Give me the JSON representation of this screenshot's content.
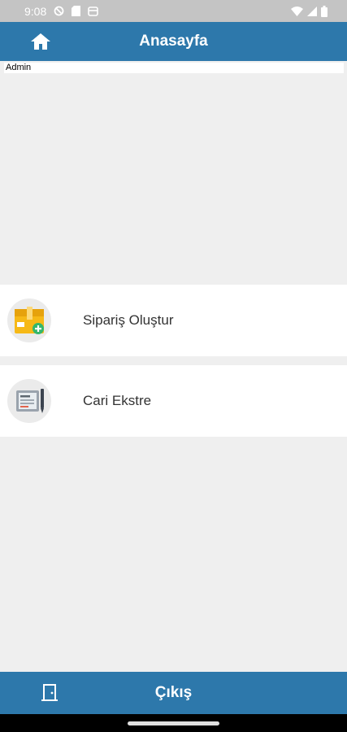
{
  "status_bar": {
    "time": "9:08",
    "icons": [
      "do-not-disturb-icon",
      "sim-card-icon",
      "debug-icon",
      "wifi-icon",
      "signal-icon",
      "battery-icon"
    ]
  },
  "app_bar": {
    "title": "Anasayfa",
    "home_icon": "home-icon",
    "color": "#2d78ab"
  },
  "user": {
    "name": "Admin"
  },
  "menu": {
    "items": [
      {
        "label": "Sipariş Oluştur",
        "icon": "package-add-icon"
      },
      {
        "label": "Cari Ekstre",
        "icon": "statement-icon"
      }
    ]
  },
  "bottom_bar": {
    "label": "Çıkış",
    "icon": "door-exit-icon"
  }
}
